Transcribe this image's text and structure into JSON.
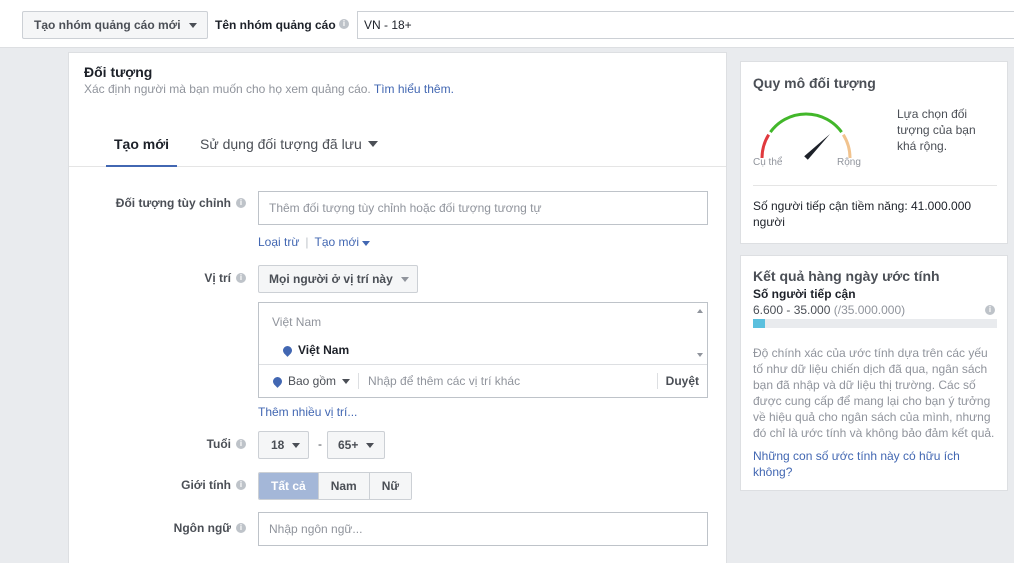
{
  "topbar": {
    "ad_group_button": "Tạo nhóm quảng cáo mới",
    "name_label": "Tên nhóm quảng cáo",
    "name_value": "VN - 18+"
  },
  "audience": {
    "title": "Đối tượng",
    "subtitle": "Xác định người mà bạn muốn cho họ xem quảng cáo.",
    "learn_more": "Tìm hiểu thêm.",
    "tabs": {
      "new": "Tạo mới",
      "saved": "Sử dụng đối tượng đã lưu"
    },
    "custom": {
      "label": "Đối tượng tùy chỉnh",
      "placeholder": "Thêm đối tượng tùy chỉnh hoặc đối tượng tương tự",
      "exclude": "Loại trừ",
      "create_new": "Tạo mới"
    },
    "location": {
      "label": "Vị trí",
      "mode": "Mọi người ở vị trí này",
      "group": "Việt Nam",
      "item": "Việt Nam",
      "include": "Bao gồm",
      "placeholder": "Nhập để thêm các vị trí khác",
      "browse": "Duyệt",
      "more": "Thêm nhiều vị trí..."
    },
    "age": {
      "label": "Tuổi",
      "min": "18",
      "dash": "-",
      "max": "65+"
    },
    "gender": {
      "label": "Giới tính",
      "all": "Tất cả",
      "male": "Nam",
      "female": "Nữ"
    },
    "language": {
      "label": "Ngôn ngữ",
      "placeholder": "Nhập ngôn ngữ..."
    }
  },
  "audience_size": {
    "title": "Quy mô đối tượng",
    "narrow": "Cụ thể",
    "broad": "Rộng",
    "description": "Lựa chọn đối tượng của bạn khá rộng.",
    "potential_reach": "Số người tiếp cận tiềm năng: 41.000.000 người",
    "gauge_level": 0.75,
    "colors": {
      "narrow": "#e0393e",
      "good": "#42b72a",
      "broad": "#f1c38e"
    }
  },
  "daily_results": {
    "title": "Kết quả hàng ngày ước tính",
    "reach_label": "Số người tiếp cận",
    "reach_range": "6.600 - 35.000",
    "reach_total": "(/35.000.000)",
    "bar_fraction": 0.05,
    "bar_color": "#5bc0de",
    "description": "Độ chính xác của ước tính dựa trên các yếu tố như dữ liệu chiến dịch đã qua, ngân sách bạn đã nhập và dữ liệu thị trường. Các số được cung cấp để mang lại cho bạn ý tưởng về hiệu quả cho ngân sách của mình, nhưng đó chỉ là ước tính và không bảo đảm kết quả.",
    "helpful_link": "Những con số ước tính này có hữu ích không?"
  }
}
